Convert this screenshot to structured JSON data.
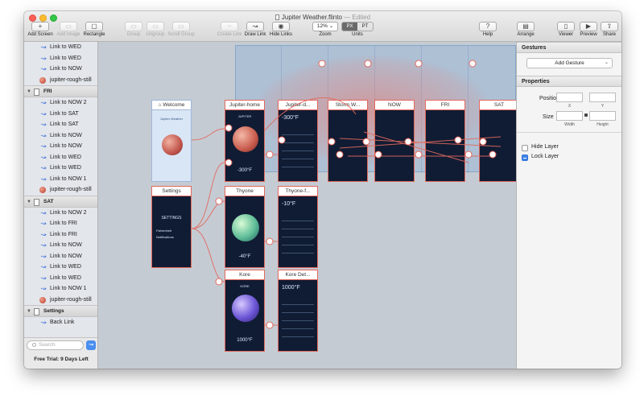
{
  "window": {
    "title": "Jupiter Weather.flinto",
    "edited_label": "— Edited"
  },
  "toolbar": {
    "add_screen": "Add Screen",
    "add_image": "Add Image",
    "rectangle": "Rectangle",
    "group": "Group",
    "ungroup": "Ungroup",
    "scroll_group": "Scroll Group",
    "create_link": "Create Link",
    "draw_link": "Draw Link",
    "hide_links": "Hide Links",
    "zoom_value": "12%",
    "zoom_label": "Zoom",
    "units_px": "PX",
    "units_pt": "PT",
    "units_label": "Units",
    "help": "Help",
    "arrange": "Arrange",
    "viewer": "Viewer",
    "preview": "Preview",
    "share": "Share"
  },
  "sidebar": {
    "rows": [
      {
        "kind": "link",
        "label": "Link to WED"
      },
      {
        "kind": "link",
        "label": "Link to WED"
      },
      {
        "kind": "link",
        "label": "Link to NOW"
      },
      {
        "kind": "still",
        "label": "jupiter-rough-still"
      },
      {
        "kind": "section",
        "label": "FRI"
      },
      {
        "kind": "link",
        "label": "Link to NOW 2"
      },
      {
        "kind": "link",
        "label": "Link to SAT"
      },
      {
        "kind": "link",
        "label": "Link to SAT"
      },
      {
        "kind": "link",
        "label": "Link to NOW"
      },
      {
        "kind": "link",
        "label": "Link to NOW"
      },
      {
        "kind": "link",
        "label": "Link to WED"
      },
      {
        "kind": "link",
        "label": "Link to WED"
      },
      {
        "kind": "link",
        "label": "Link to NOW 1"
      },
      {
        "kind": "still",
        "label": "jupiter-rough-still"
      },
      {
        "kind": "section",
        "label": "SAT"
      },
      {
        "kind": "link",
        "label": "Link to NOW 2"
      },
      {
        "kind": "link",
        "label": "Link to FRI"
      },
      {
        "kind": "link",
        "label": "Link to FRI"
      },
      {
        "kind": "link",
        "label": "Link to NOW"
      },
      {
        "kind": "link",
        "label": "Link to NOW"
      },
      {
        "kind": "link",
        "label": "Link to WED"
      },
      {
        "kind": "link",
        "label": "Link to WED"
      },
      {
        "kind": "link",
        "label": "Link to NOW 1"
      },
      {
        "kind": "still",
        "label": "jupiter-rough-still"
      },
      {
        "kind": "section",
        "label": "Settings"
      },
      {
        "kind": "link",
        "label": "Back Link"
      }
    ],
    "search_placeholder": "Search",
    "trial": "Free Trial: 9 Days Left"
  },
  "canvas": {
    "screens": {
      "welcome": {
        "title": "Welcome",
        "app_name": "Jupiter Weather"
      },
      "jupiter_home": {
        "title": "Jupiter-home",
        "label": "JUPITER",
        "temp": "-300°F"
      },
      "jupiter_detail": {
        "title": "Jupiter-d...",
        "temp": "-300°F"
      },
      "storm_w": {
        "title": "Storm W..."
      },
      "now": {
        "title": "NOW"
      },
      "fri": {
        "title": "FRI"
      },
      "sat": {
        "title": "SAT"
      },
      "settings": {
        "title": "Settings",
        "heading": "SETTINGS",
        "opt1": "Fahrenheit",
        "opt2": "Notifications"
      },
      "thyone": {
        "title": "Thyone",
        "temp": "-40°F"
      },
      "thyone_detail": {
        "title": "Thyone-f...",
        "temp": "-10°F"
      },
      "kore": {
        "title": "Kore",
        "label": "KORE",
        "temp": "1000°F"
      },
      "kore_detail": {
        "title": "Kore Det...",
        "temp": "1000°F"
      }
    }
  },
  "inspector": {
    "gestures_header": "Gestures",
    "add_gesture": "Add Gesture",
    "properties_header": "Properties",
    "position_label": "Position",
    "x_label": "X",
    "y_label": "Y",
    "size_label": "Size",
    "width_label": "Width",
    "height_label": "Height",
    "hide_layer": "Hide Layer",
    "lock_layer": "Lock Layer",
    "hide_layer_checked": false,
    "lock_layer_checked": true
  },
  "colors": {
    "link_line": "#e2695f",
    "accent": "#3f84e8",
    "canvas_bg": "#c5cbd3",
    "screen_dark": "#101c33"
  }
}
